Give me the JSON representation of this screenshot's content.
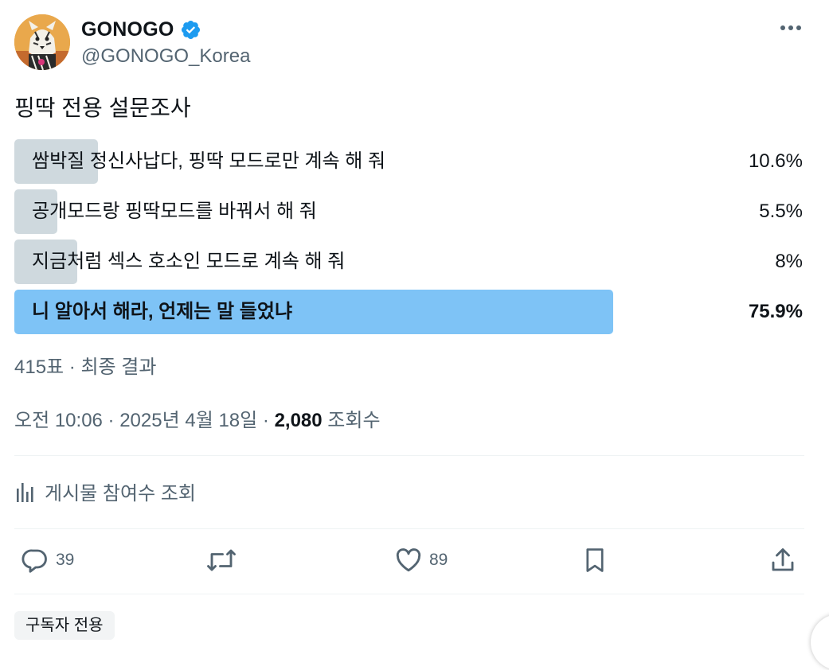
{
  "author": {
    "name": "GONOGO",
    "handle": "@GONOGO_Korea",
    "verified": true,
    "verified_color": "#1d9bf0"
  },
  "tweet": {
    "text": "핑딱 전용 설문조사"
  },
  "poll": {
    "options": [
      {
        "label": "쌈박질 정신사납다, 핑딱 모드로만 계속 해 줘",
        "percent_text": "10.6%",
        "percent": 10.6,
        "winner": false
      },
      {
        "label": "공개모드랑 핑딱모드를 바꿔서 해 줘",
        "percent_text": "5.5%",
        "percent": 5.5,
        "winner": false
      },
      {
        "label": "지금처럼 섹스 호소인 모드로 계속 해 줘",
        "percent_text": "8%",
        "percent": 8,
        "winner": false
      },
      {
        "label": "니 알아서 해라, 언제는 말 들었냐",
        "percent_text": "75.9%",
        "percent": 75.9,
        "winner": true
      }
    ],
    "meta": "415표 · 최종 결과",
    "bar_color": "#cfd9de",
    "winner_color": "#7ec3f6"
  },
  "timestamp": {
    "time": "오전 10:06 · 2025년 4월 18일 · ",
    "views": "2,080",
    "views_label": " 조회수"
  },
  "analytics_label": "게시물 참여수 조회",
  "actions": {
    "reply_count": "39",
    "like_count": "89"
  },
  "badge": "구독자 전용",
  "icons": [
    "verified-icon",
    "more-icon",
    "analytics-icon",
    "reply-icon",
    "retweet-icon",
    "like-icon",
    "bookmark-icon",
    "share-icon"
  ]
}
